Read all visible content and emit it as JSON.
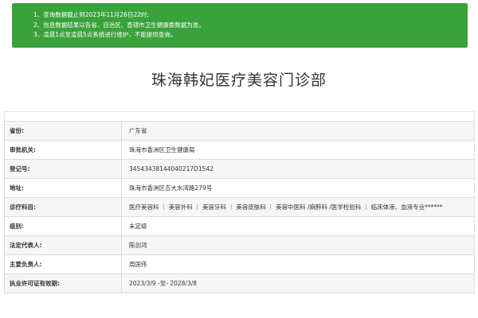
{
  "notice": {
    "lines": [
      "1、查询数据截止到2023年11月26日22时;",
      "2、信息数据结果以各省、自治区、直辖市卫生健康委数据为准。",
      "3、凌晨1点至凌晨5点系统进行维护，不能提供查询。"
    ]
  },
  "title": "珠海韩妃医疗美容门诊部",
  "rows": [
    {
      "label": "省份:",
      "value": "广东省"
    },
    {
      "label": "审批机关:",
      "value": "珠海市香洲区卫生健康局"
    },
    {
      "label": "登记号:",
      "value": "34543438144040217D1542"
    },
    {
      "label": "地址:",
      "value": "珠海市香洲区吉大水湾路279号"
    },
    {
      "label": "诊疗科目:",
      "value": "医疗美容科 ｜ 美容外科 ｜ 美容牙科 ｜ 美容皮肤科 ｜ 美容中医科 /麻醉科 /医学检验科 ｜ 临床体液、血液专业******"
    },
    {
      "label": "级别:",
      "value": "未定级"
    },
    {
      "label": "法定代表人:",
      "value": "陈剑鸿"
    },
    {
      "label": "主要负责人:",
      "value": "周国伟"
    },
    {
      "label": "执业许可证有效期:",
      "value": "2023/3/9 -至- 2028/3/8"
    }
  ],
  "colors": {
    "notice_bg": "#3aa23c",
    "notice_text": "#ffffff",
    "row_alt_bg": "#f6f6f6",
    "border": "#dcdcdc"
  }
}
